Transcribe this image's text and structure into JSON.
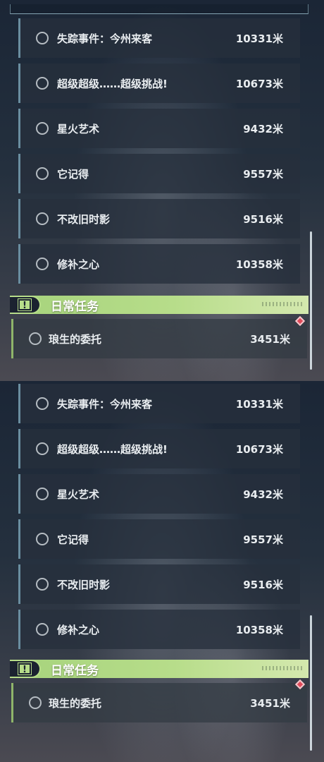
{
  "quest_list": [
    {
      "name": "失踪事件：今州来客",
      "distance": "10331米"
    },
    {
      "name": "超级超级……超级挑战!",
      "distance": "10673米"
    },
    {
      "name": "星火艺术",
      "distance": "9432米"
    },
    {
      "name": "它记得",
      "distance": "9557米"
    },
    {
      "name": "不改旧时影",
      "distance": "9516米"
    },
    {
      "name": "修补之心",
      "distance": "10358米"
    }
  ],
  "daily_section": {
    "title": "日常任务",
    "icon_glyph": "!",
    "quest": {
      "name": "琅生的委托",
      "distance": "3451米"
    }
  },
  "colors": {
    "accent_green": "#b7dd8a",
    "marker_red": "#e04a5a",
    "row_border_blue": "#6a8ea0"
  },
  "icons": {
    "quest_status": "circle-outline-icon",
    "daily_header": "exclamation-box-icon",
    "tracked_marker": "diamond-marker-icon"
  }
}
